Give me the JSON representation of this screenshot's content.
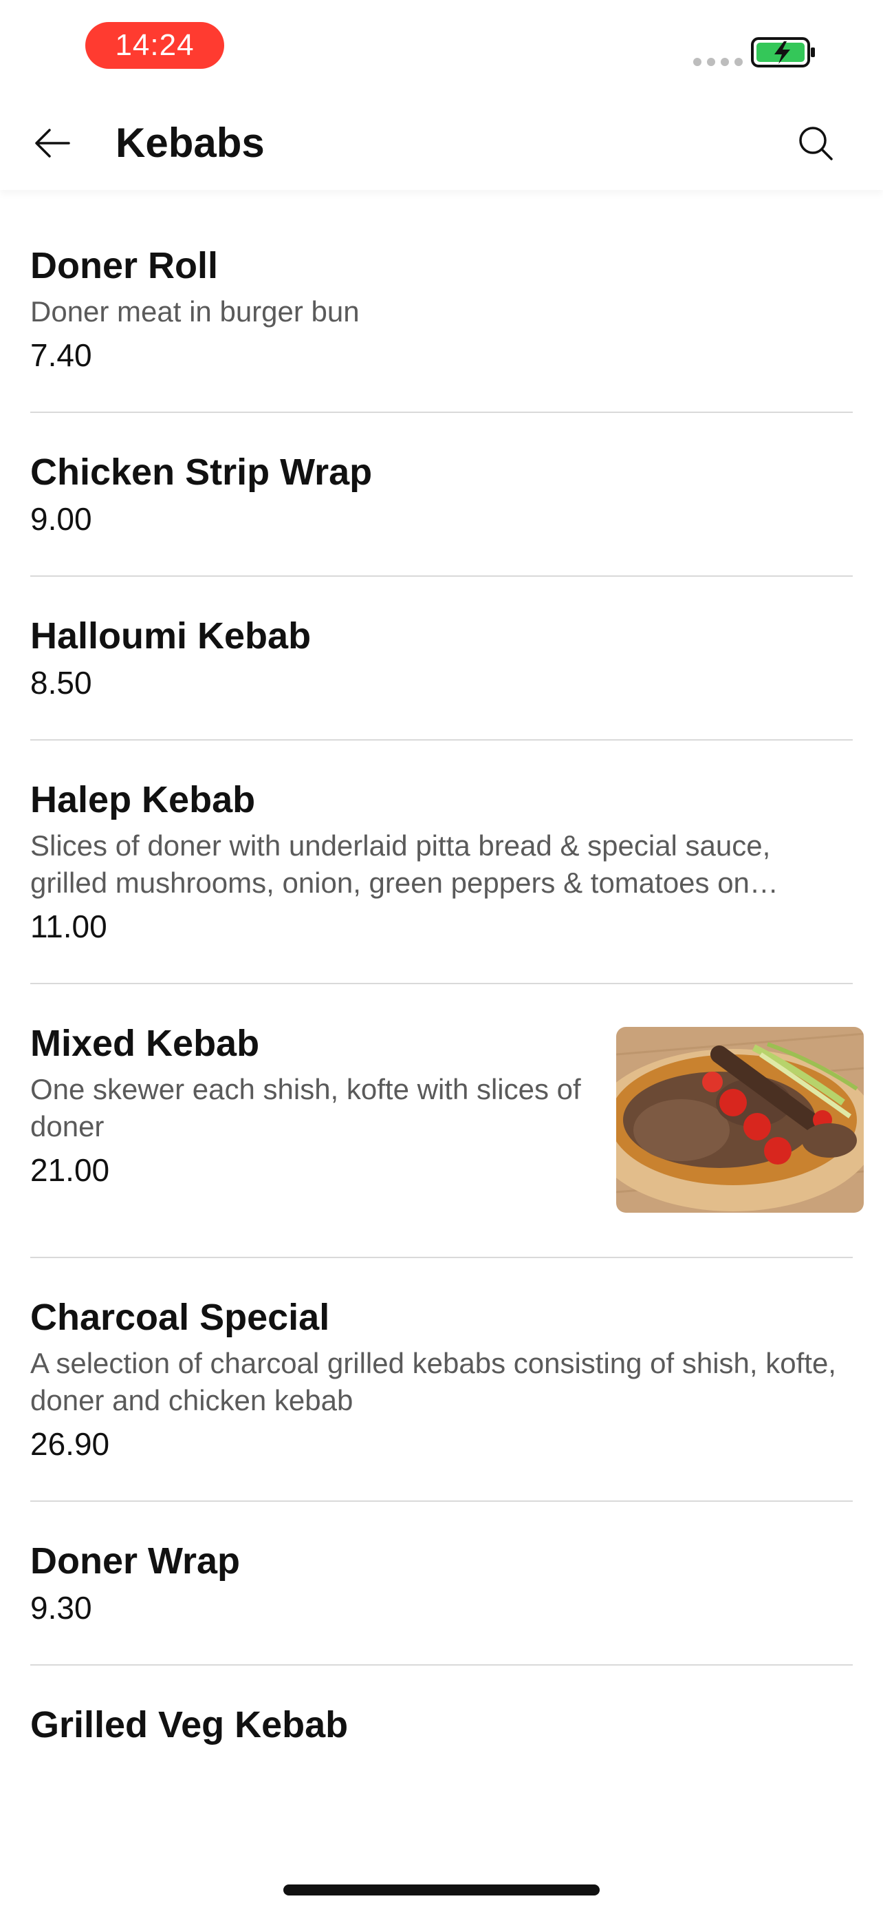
{
  "status_bar": {
    "time": "14:24",
    "time_pill_color": "#ff3b30",
    "battery_color": "#34c759",
    "icons": [
      "signal-icon",
      "battery-charging-icon"
    ]
  },
  "header": {
    "title": "Kebabs",
    "back_icon": "arrow-left-icon",
    "search_icon": "search-icon"
  },
  "items": [
    {
      "name": "Doner Roll",
      "description": "Doner meat in burger bun",
      "price": "7.40"
    },
    {
      "name": "Chicken Strip Wrap",
      "description": "",
      "price": "9.00"
    },
    {
      "name": "Halloumi Kebab",
      "description": "",
      "price": "8.50"
    },
    {
      "name": "Halep Kebab",
      "description": "Slices of doner with underlaid pitta bread & special sauce, grilled mushrooms, onion, green peppers & tomatoes on skewers",
      "price": "11.00"
    },
    {
      "name": "Mixed Kebab",
      "description": "One skewer each shish, kofte with slices of doner",
      "price": "21.00",
      "has_image": true
    },
    {
      "name": "Charcoal Special",
      "description": "A selection of charcoal grilled kebabs consisting of shish, kofte, doner and chicken kebab",
      "price": "26.90"
    },
    {
      "name": "Doner Wrap",
      "description": "",
      "price": "9.30"
    },
    {
      "name": "Grilled Veg Kebab",
      "description": "",
      "price": ""
    }
  ]
}
